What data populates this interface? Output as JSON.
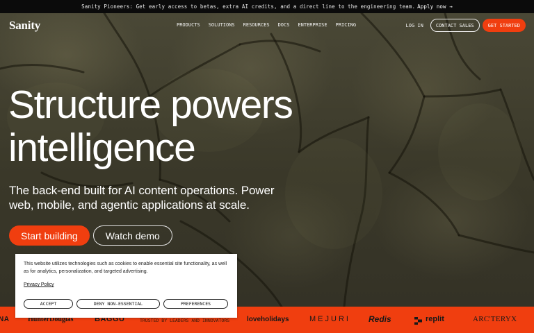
{
  "announcement": {
    "text": "Sanity Pioneers: Get early access to betas, extra AI credits, and a direct line to the engineering team.",
    "link": "Apply now →"
  },
  "nav": {
    "logo": "Sanity",
    "links": [
      "PRODUCTS",
      "SOLUTIONS",
      "RESOURCES",
      "DOCS",
      "ENTERPRISE",
      "PRICING"
    ],
    "login": "LOG IN",
    "contact": "CONTACT SALES",
    "get_started": "GET STARTED"
  },
  "hero": {
    "headline_line1": "Structure powers",
    "headline_line2": "intelligence",
    "subhead": "The back-end built for AI content operations. Power web, mobile, and agentic applications at scale.",
    "primary_cta": "Start building",
    "secondary_cta": "Watch demo"
  },
  "cookie": {
    "message": "This website utilizes technologies such as cookies to enable essential site functionality, as well as for analytics, personalization, and targeted advertising.",
    "policy_link": "Privacy Policy",
    "accept": "ACCEPT",
    "deny": "DENY NON-ESSENTIAL",
    "preferences": "PREFERENCES"
  },
  "logo_strip": {
    "trusted_label": "TRUSTED BY LEADERS AND INNOVATORS",
    "logos": [
      "NA",
      "HunterDouglas",
      "BAGGU",
      "loveholidays",
      "MEJURI",
      "Redis",
      "replit",
      "ARC'TERYX"
    ]
  },
  "colors": {
    "accent": "#f03e0f",
    "announcement_bg": "#0b0b0b",
    "hero_bg": "#3c3a2d"
  }
}
